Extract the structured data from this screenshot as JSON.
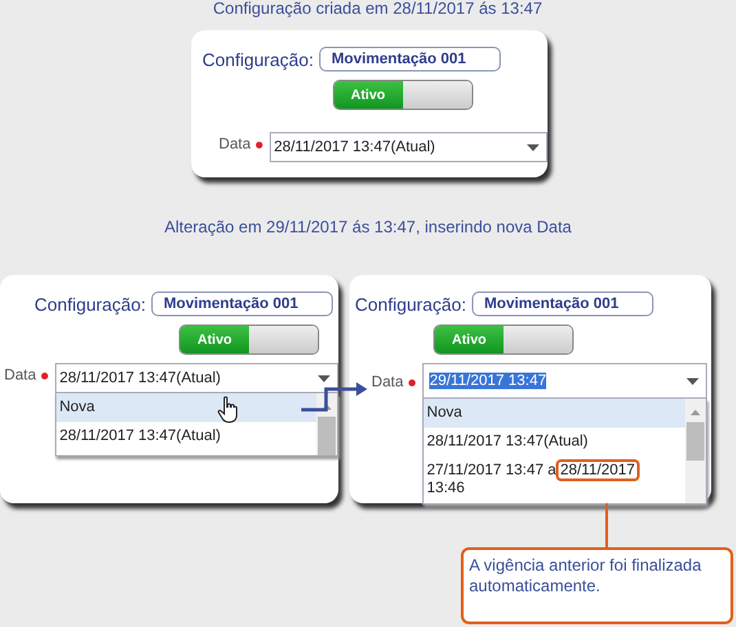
{
  "sections": [
    {
      "heading": "Configuração criada em 28/11/2017 ás 13:47",
      "panels": [
        {
          "config_label": "Configuração:",
          "config_value": "Movimentação 001",
          "toggle": {
            "label": "Ativo",
            "on": true
          },
          "date_label": "Data",
          "date_value": "28/11/2017 13:47(Atual)",
          "date_text_selected": false
        }
      ]
    },
    {
      "heading": "Alteração em 29/11/2017 ás 13:47, inserindo nova Data",
      "panels": [
        {
          "config_label": "Configuração:",
          "config_value": "Movimentação 001",
          "toggle": {
            "label": "Ativo",
            "on": true
          },
          "date_label": "Data",
          "date_value": "28/11/2017 13:47(Atual)",
          "date_text_selected": false,
          "dropdown": {
            "expanded": true,
            "options": [
              {
                "label": "Nova",
                "selected": true
              },
              {
                "label": "28/11/2017 13:47(Atual)",
                "selected": false
              }
            ]
          },
          "cursor": true
        },
        {
          "config_label": "Configuração:",
          "config_value": "Movimentação 001",
          "toggle": {
            "label": "Ativo",
            "on": true
          },
          "date_label": "Data",
          "date_value": "29/11/2017 13:47",
          "date_text_selected": true,
          "dropdown": {
            "expanded": true,
            "options": [
              {
                "label": "Nova",
                "selected": true
              },
              {
                "label": "28/11/2017 13:47(Atual)",
                "selected": false
              },
              {
                "label": "27/11/2017 13:47 a",
                "highlighted": "28/11/2017",
                "suffix": "13:46",
                "selected": false
              }
            ]
          }
        }
      ]
    }
  ],
  "callout": {
    "text": "A vigência anterior foi finalizada automaticamente."
  }
}
